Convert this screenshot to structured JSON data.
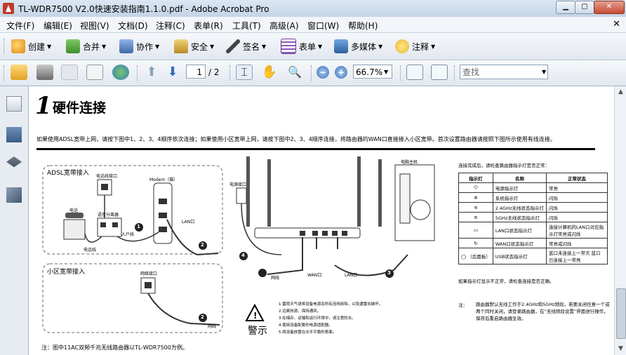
{
  "window": {
    "title": "TL-WDR7500 V2.0快速安装指南1.1.0.pdf - Adobe Acrobat Pro"
  },
  "menu": [
    "文件(F)",
    "编辑(E)",
    "视图(V)",
    "文档(D)",
    "注释(C)",
    "表单(R)",
    "工具(T)",
    "高级(A)",
    "窗口(W)",
    "帮助(H)"
  ],
  "toolbar1": {
    "create": "创建",
    "combine": "合并",
    "collaborate": "协作",
    "secure": "安全",
    "sign": "签名",
    "forms": "表单",
    "multimedia": "多媒体",
    "comment": "注释"
  },
  "toolbar2": {
    "page_current": "1",
    "page_total": "/ 2",
    "zoom": "66.7%",
    "find_placeholder": "查找"
  },
  "doc": {
    "section_number": "1",
    "section_title": "硬件连接",
    "intro": "如果使用ADSL宽带上网，请按下图中1、2、3、4顺序依次连接；如果使用小区宽带上网，请按下图中2、3、4顺序连接，将路由器的WAN口直接接入小区宽带。首次设置路由器请按照下图所示使用有线连接。",
    "adsl_title": "ADSL宽带接入",
    "adsl_labels": {
      "phone_line": "电话线接口",
      "modem": "Modem（猫）",
      "phone": "电话",
      "splitter": "语音分离器",
      "out_line": "入户线",
      "phone_cable": "电话线",
      "lan": "LAN口"
    },
    "community_title": "小区宽带接入",
    "community_labels": {
      "port": "网络接口",
      "cable": "网线"
    },
    "router_labels": {
      "power": "电源接口",
      "host": "电脑主机",
      "wan": "WAN口",
      "lan": "LAN口",
      "cable": "网线"
    },
    "step_badges": [
      "1",
      "2",
      "3",
      "4",
      "2"
    ],
    "warning_title": "警示",
    "warnings": [
      "1.雷雨天气请将设备电源及所有连线拆除，以免遭雷击破坏。",
      "2.远离热源，保持通风。",
      "3.在储存、运输和运行环境中，请注意防水。",
      "4.使用设备配套的电源适配器。",
      "5.将设备放置在水平平稳的表面。"
    ],
    "note_bottom": "注：图中11AC双频千兆无线路由器以TL-WDR7500为例。",
    "table_intro": "连接完成后，请检查路由器指示灯是否正常：",
    "table_headers": [
      "指示灯",
      "名称",
      "正常状态"
    ],
    "table_rows": [
      [
        "⏻",
        "电源指示灯",
        "常亮"
      ],
      [
        "✲",
        "系统指示灯",
        "闪烁"
      ],
      [
        "≋",
        "2.4GHz无线状态指示灯",
        "闪烁"
      ],
      [
        "≋",
        "5GHz无线状态指示灯",
        "闪烁"
      ],
      [
        "▭",
        "LAN口状态指示灯",
        "连接计算机的LAN口对应指示灯常亮或闪烁"
      ],
      [
        "↻",
        "WAN口状态指示灯",
        "常亮或闪烁"
      ],
      [
        "◯ （后面板）",
        "USB状态指示灯",
        "蓝口未连接上一常灭 蓝口已连接上一常亮"
      ]
    ],
    "table_after": "如果指示灯显示不正常，请检查连接是否正确。",
    "note_right_label": "注：",
    "note_right": "路由器默认无线工作于2.4GHz和5GHz频段，若要关闭任意一个或两个同时关闭，请登录路由器，在“无线频段设置”界面进行操作，保存后重启路由器生效。"
  },
  "colors": {
    "accent": "#2b5ea8"
  }
}
